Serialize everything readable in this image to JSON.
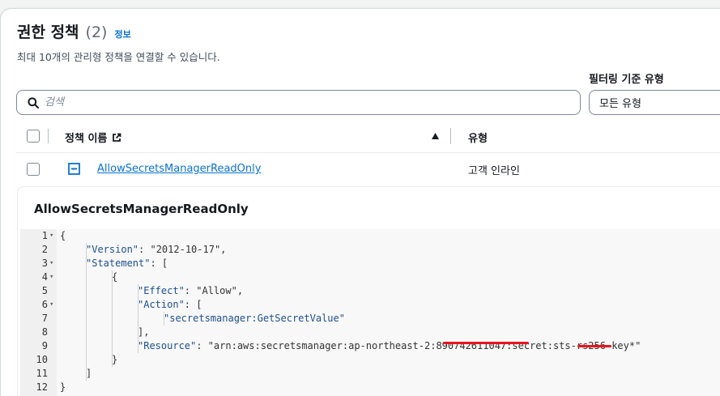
{
  "header": {
    "title": "권한 정책",
    "count": "(2)",
    "info_link": "정보",
    "description": "최대 10개의 관리형 정책을 연결할 수 있습니다."
  },
  "filter": {
    "label": "필터링 기준 유형",
    "search_placeholder": "검색",
    "type_value": "모든 유형"
  },
  "table": {
    "columns": {
      "name": "정책 이름",
      "type": "유형"
    },
    "rows": [
      {
        "name": "AllowSecretsManagerReadOnly",
        "type": "고객 인라인",
        "expanded": true
      }
    ]
  },
  "detail": {
    "title": "AllowSecretsManagerReadOnly",
    "code_lines": [
      {
        "n": "1",
        "fold": true,
        "indent": 0,
        "text": "{"
      },
      {
        "n": "2",
        "fold": false,
        "indent": 1,
        "key": "\"Version\"",
        "rest": ": \"2012-10-17\","
      },
      {
        "n": "3",
        "fold": true,
        "indent": 1,
        "key": "\"Statement\"",
        "rest": ": ["
      },
      {
        "n": "4",
        "fold": true,
        "indent": 2,
        "text": "{"
      },
      {
        "n": "5",
        "fold": false,
        "indent": 3,
        "key": "\"Effect\"",
        "rest": ": \"Allow\","
      },
      {
        "n": "6",
        "fold": true,
        "indent": 3,
        "key": "\"Action\"",
        "rest": ": ["
      },
      {
        "n": "7",
        "fold": false,
        "indent": 4,
        "text": "\"secretsmanager:GetSecretValue\""
      },
      {
        "n": "8",
        "fold": false,
        "indent": 3,
        "text": "],"
      },
      {
        "n": "9",
        "fold": false,
        "indent": 3,
        "key": "\"Resource\"",
        "rest": ": \"arn:aws:secretsmanager:ap-northeast-2:890742611047:secret:sts-rs256-key*\""
      },
      {
        "n": "10",
        "fold": false,
        "indent": 2,
        "text": "}"
      },
      {
        "n": "11",
        "fold": false,
        "indent": 1,
        "text": "]"
      },
      {
        "n": "12",
        "fold": false,
        "indent": 0,
        "text": "}"
      }
    ]
  },
  "colors": {
    "link": "#0972d3",
    "redaction": "#e8141e"
  }
}
